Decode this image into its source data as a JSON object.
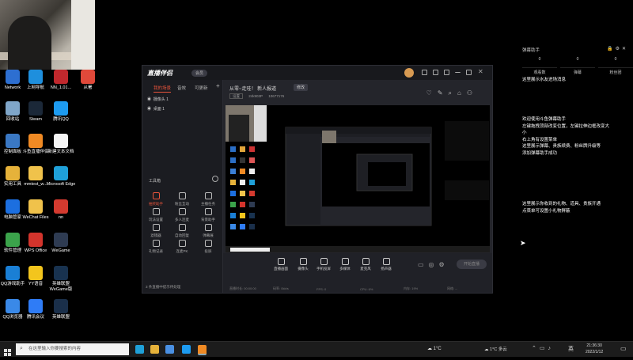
{
  "desktop": {
    "icons": [
      {
        "label": "Network",
        "color": "#2d6fd1"
      },
      {
        "label": "上网导航",
        "color": "#1e8fdd"
      },
      {
        "label": "NN_1.01...",
        "color": "#c0282d"
      },
      {
        "label": "从署",
        "color": "#e0493a"
      },
      {
        "label": "回收站",
        "color": "#7fa6c9"
      },
      {
        "label": "Steam",
        "color": "#1b2838"
      },
      {
        "label": "腾讯QQ",
        "color": "#1d9bf0"
      },
      {
        "label": "控制面板",
        "color": "#3a78c4"
      },
      {
        "label": "斗鱼直播伴侣",
        "color": "#f08a24"
      },
      {
        "label": "新建文本文档",
        "color": "#f5f5f5"
      },
      {
        "label": "实用工具",
        "color": "#e6b23a"
      },
      {
        "label": "mmtest_w...",
        "color": "#f0c24b"
      },
      {
        "label": "Microsoft Edge",
        "color": "#1fa0d8"
      },
      {
        "label": "电脑管家",
        "color": "#1c6fe0"
      },
      {
        "label": "WeChat Files",
        "color": "#f0c24b"
      },
      {
        "label": "nn",
        "color": "#d43a2f"
      },
      {
        "label": "软件管理",
        "color": "#3ba34b"
      },
      {
        "label": "WPS Office",
        "color": "#d3342c"
      },
      {
        "label": "WeGame",
        "color": "#2e3b52"
      },
      {
        "label": "QQ游戏助手",
        "color": "#1a7fd5"
      },
      {
        "label": "YY语音",
        "color": "#f3c51d"
      },
      {
        "label": "英雄联盟WeGame版",
        "color": "#18324f"
      },
      {
        "label": "QQ浏览器",
        "color": "#3a89e8"
      },
      {
        "label": "腾讯会议",
        "color": "#2f7cf6"
      },
      {
        "label": "英雄联盟",
        "color": "#1a2f4a"
      }
    ]
  },
  "app": {
    "title": "直播伴侣",
    "vip": "会员",
    "tabs": [
      "我的场景",
      "音效",
      "可更新"
    ],
    "scenes": [
      {
        "label": "摄像头 1"
      },
      {
        "label": "桌面 1"
      }
    ],
    "toolbox_label": "工具箱",
    "tools": [
      "抽奖助手",
      "粉丝互动",
      "主播任务",
      "玩法设置",
      "多人连麦",
      "背景助手",
      "滤镜器",
      "自动回复",
      "弹幕展",
      "礼物记录",
      "连麦PK",
      "投屏"
    ],
    "room_title": "从零~走哇！ 新人报道",
    "room_btn": "修改",
    "room_meta": [
      "设置",
      "24k903P",
      "10677176"
    ],
    "bottom_buttons": [
      "直播画面",
      "摄像头",
      "手机投屏",
      "多媒体",
      "麦克风",
      "扬声器"
    ],
    "start_label": "开始直播",
    "notice": "3 条直播中提示待处理",
    "status": [
      "直播时长: 00:00:00",
      "码率: 0kb/s",
      "FPS: 0",
      "CPU: 6%",
      "内存: 19%",
      "网络: --"
    ]
  },
  "right_panel": {
    "title": "弹幕助手",
    "counters": [
      {
        "label": "观看数",
        "value": "0"
      },
      {
        "label": "弹幕",
        "value": "0"
      },
      {
        "label": "粉丝团",
        "value": "0"
      }
    ],
    "msg1": "这里展示水友进场消息",
    "welcome": [
      "欢迎使用斗鱼弹幕助手",
      "左键拖拽顶部改变位置，左键拉伸边框改变大",
      "小",
      "右上角有设置菜单",
      "这里展示弹幕、贵族续费、粉丝牌升级等",
      "添加弹幕助手成功"
    ],
    "gift": [
      "这里展示你收到的礼物、道具、贵族开通",
      "点菜单可设置小礼物屏蔽"
    ]
  },
  "taskbar": {
    "search_placeholder": "在这里输入你要搜索的内容",
    "weather": "1°C",
    "weather2": "1°C 多云",
    "time": "21:36:30",
    "date": "2022/1/12",
    "lang": "英"
  }
}
